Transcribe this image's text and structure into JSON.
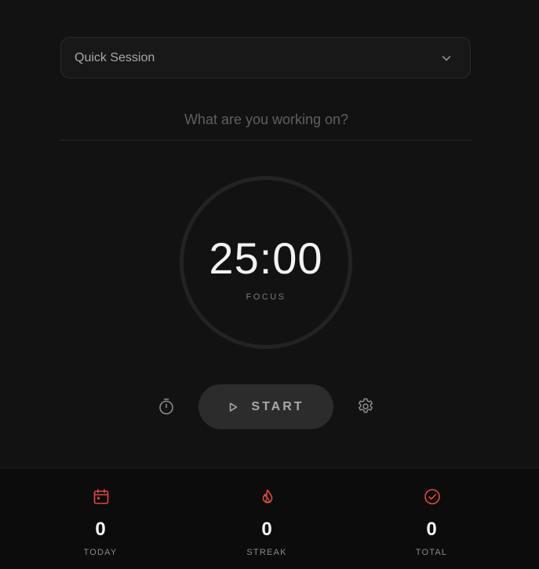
{
  "session": {
    "selected": "Quick Session"
  },
  "task": {
    "placeholder": "What are you working on?",
    "value": ""
  },
  "timer": {
    "time": "25:00",
    "mode": "FOCUS"
  },
  "controls": {
    "start_label": "START",
    "left_icon": "stopwatch-icon",
    "right_icon": "gear-icon",
    "play_icon": "play-icon"
  },
  "stats": [
    {
      "icon": "calendar-icon",
      "value": "0",
      "label": "TODAY"
    },
    {
      "icon": "flame-icon",
      "value": "0",
      "label": "STREAK"
    },
    {
      "icon": "check-circle-icon",
      "value": "0",
      "label": "TOTAL"
    }
  ],
  "colors": {
    "background": "#121212",
    "accent": "#e5483d",
    "stats_background": "#0c0c0c",
    "button_background": "#2c2c2c"
  }
}
